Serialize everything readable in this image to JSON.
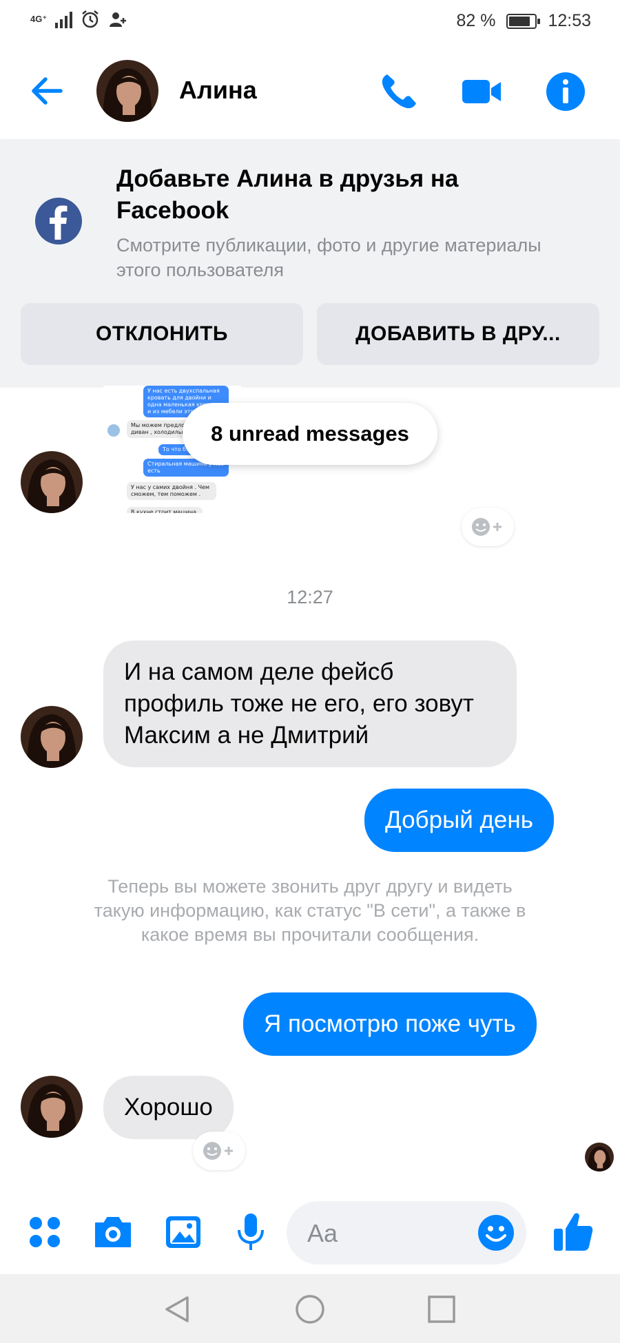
{
  "status_bar": {
    "network": "4G⁺",
    "battery_level_percent": 82,
    "battery_text": "82 %",
    "time": "12:53"
  },
  "header": {
    "contact_name": "Алина",
    "icons": [
      "back-arrow-icon",
      "phone-icon",
      "video-camera-icon",
      "info-icon"
    ]
  },
  "friend_card": {
    "title": "Добавьте Алина в друзья на Facebook",
    "subtitle": "Смотрите публикации, фото и другие материалы этого пользователя",
    "decline_label": "ОТКЛОНИТЬ",
    "add_label": "ДОБАВИТЬ В ДРУ..."
  },
  "screenshot_preview": {
    "lines": [
      "У нас есть двухспальная кровать для двойни и одна маленькая кроватка и из мебели это",
      "Мы можем предло... диван , холодильн...",
      "То что б...",
      "Стиральная машина у нас есть",
      "У нас у самих двойня . Чем сможем, тем поможем .",
      "В кухне стоит машина"
    ]
  },
  "unread_pill": "8 unread messages",
  "timestamp": "12:27",
  "messages": {
    "m1": "И на самом деле фейсб профиль тоже не его, его зовут Максим а не Дмитрий",
    "m2": "Добрый день",
    "system_notice": "Теперь вы можете звонить друг другу и видеть такую информацию, как статус \"В сети\", а также в какое время вы прочитали сообщения.",
    "m3": "Я посмотрю поже чуть",
    "m4": "Хорошо"
  },
  "composer": {
    "placeholder": "Aa",
    "icons": [
      "apps-icon",
      "camera-icon",
      "gallery-icon",
      "microphone-icon",
      "emoji-icon",
      "thumbs-up-icon"
    ]
  },
  "colors": {
    "accent": "#0084ff",
    "incoming_bubble": "#e9e9eb",
    "card_background": "#f1f2f4",
    "facebook_blue": "#3b5998"
  }
}
